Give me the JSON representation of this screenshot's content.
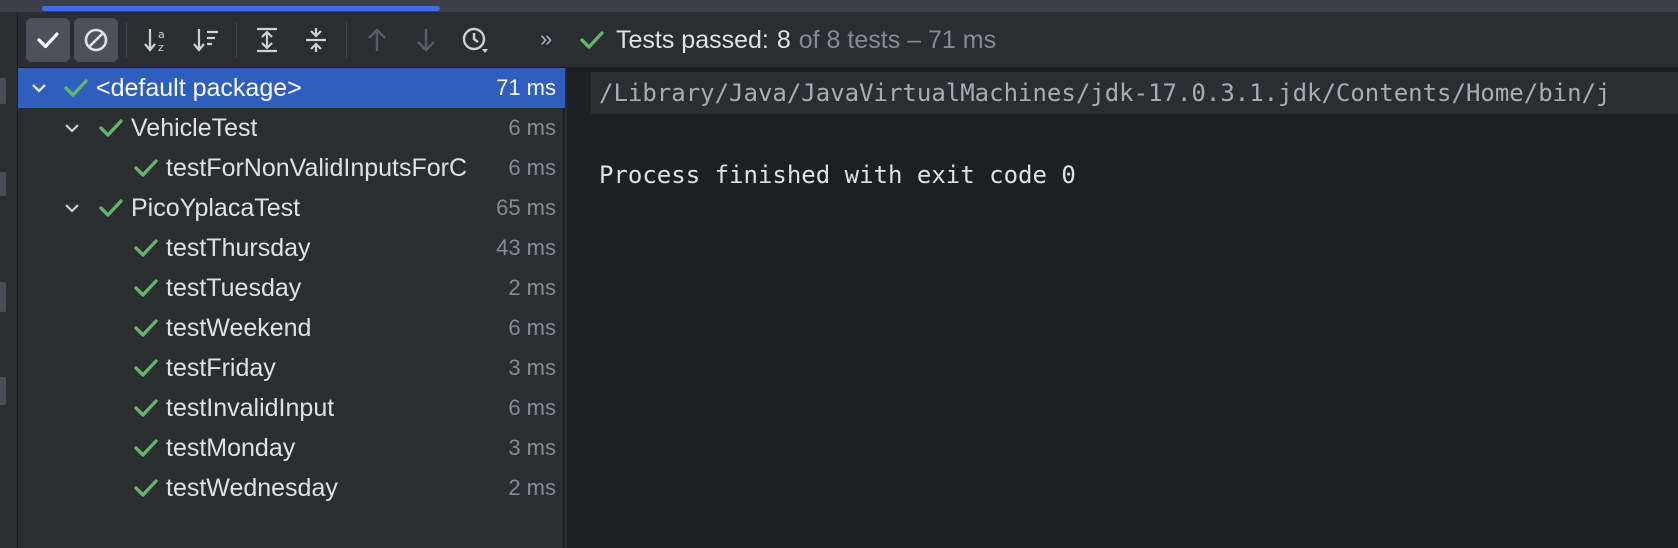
{
  "toolbar": {
    "status": {
      "prefix": "Tests passed:",
      "passed": "8",
      "suffix": "of 8 tests – 71 ms"
    }
  },
  "tree": {
    "rows": [
      {
        "label": "<default package>",
        "duration": "71 ms"
      },
      {
        "label": "VehicleTest",
        "duration": "6 ms"
      },
      {
        "label": "testForNonValidInputsForC",
        "duration": "6 ms"
      },
      {
        "label": "PicoYplacaTest",
        "duration": "65 ms"
      },
      {
        "label": "testThursday",
        "duration": "43 ms"
      },
      {
        "label": "testTuesday",
        "duration": "2 ms"
      },
      {
        "label": "testWeekend",
        "duration": "6 ms"
      },
      {
        "label": "testFriday",
        "duration": "3 ms"
      },
      {
        "label": "testInvalidInput",
        "duration": "6 ms"
      },
      {
        "label": "testMonday",
        "duration": "3 ms"
      },
      {
        "label": "testWednesday",
        "duration": "2 ms"
      }
    ]
  },
  "console": {
    "command": "/Library/Java/JavaVirtualMachines/jdk-17.0.3.1.jdk/Contents/Home/bin/j",
    "exit_message": "Process finished with exit code 0"
  },
  "colors": {
    "accent": "#3574f0",
    "selection": "#2e5fbf",
    "pass_green": "#5fb865",
    "background": "#2b2d30",
    "console_bg": "#1e1f22"
  },
  "icons": [
    "show-passed-icon",
    "show-ignored-icon",
    "sort-alphabetically-icon",
    "sort-by-duration-icon",
    "expand-all-icon",
    "collapse-all-icon",
    "previous-failed-icon",
    "next-failed-icon",
    "test-history-icon",
    "more-chevron-icon",
    "passed-check-icon",
    "expand-arrow-icon"
  ]
}
